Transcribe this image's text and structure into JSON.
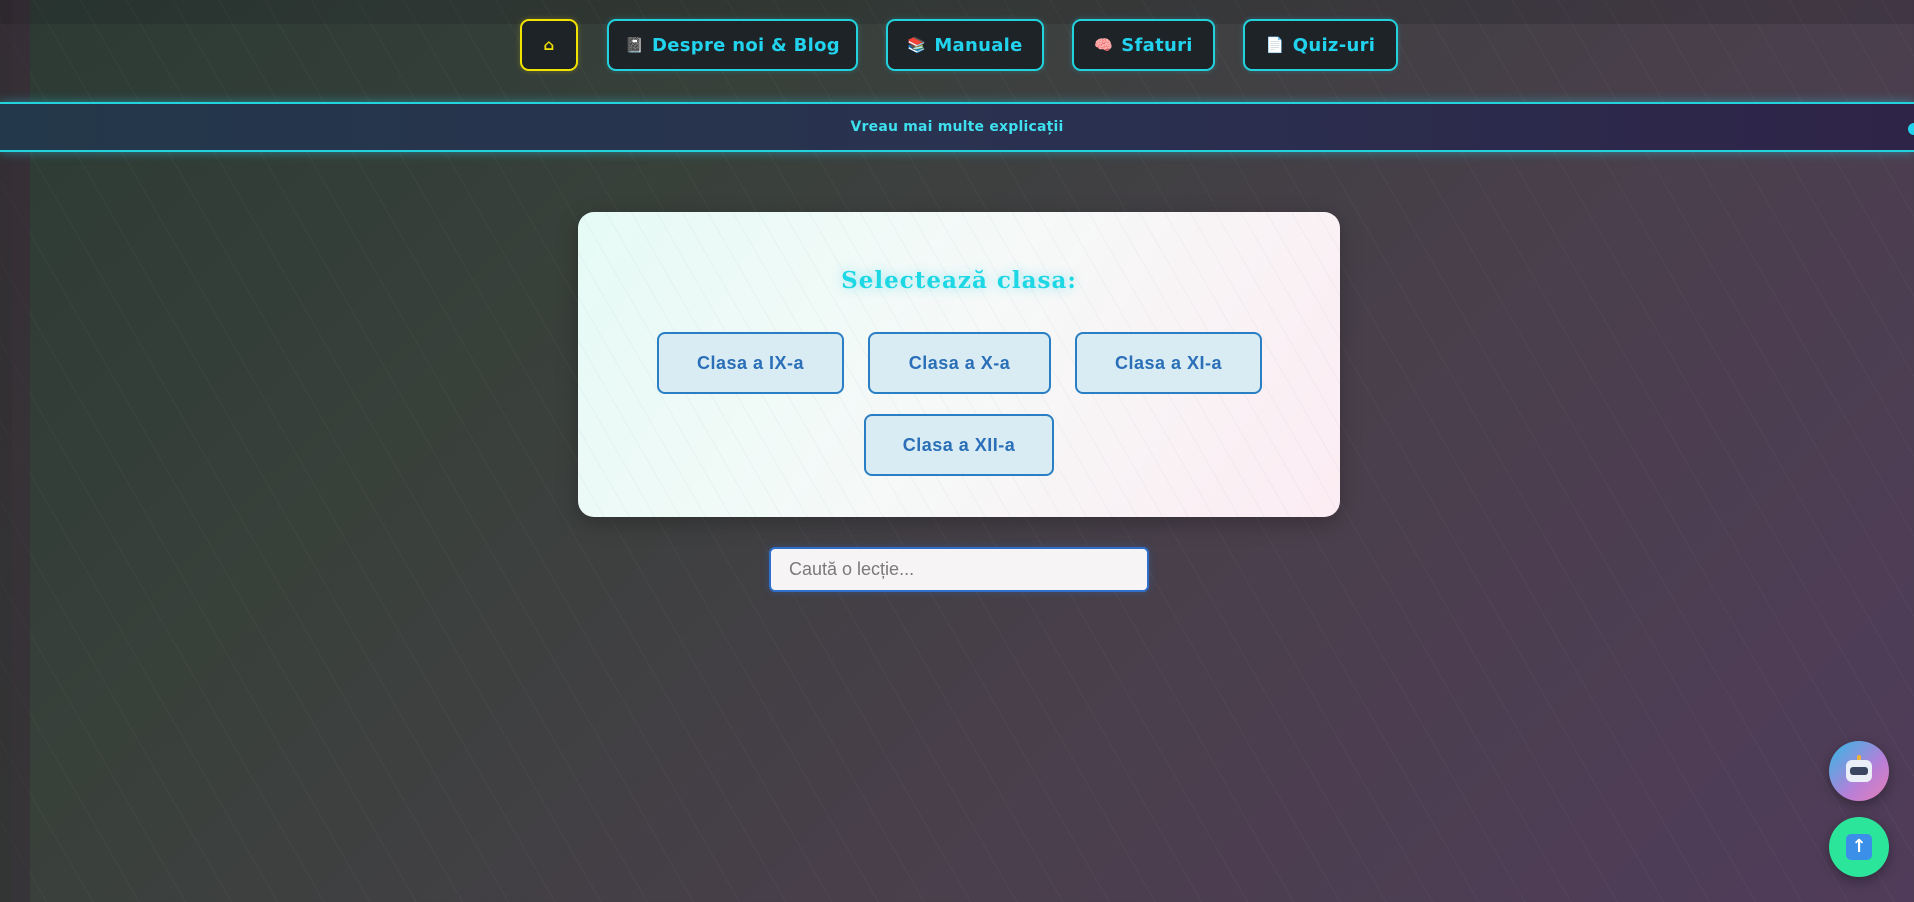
{
  "nav": {
    "home": {
      "icon": "home-icon",
      "glyph": "⌂"
    },
    "items": [
      {
        "label": "Despre noi & Blog",
        "icon": "notebook-icon",
        "glyph": "📓"
      },
      {
        "label": "Manuale",
        "icon": "books-icon",
        "glyph": "📚"
      },
      {
        "label": "Sfaturi",
        "icon": "brain-icon",
        "glyph": "🧠"
      },
      {
        "label": "Quiz-uri",
        "icon": "document-icon",
        "glyph": "📄"
      }
    ]
  },
  "banner": {
    "text": "Vreau mai multe explicații"
  },
  "class_selector": {
    "title": "Selectează clasa:",
    "classes": [
      "Clasa a IX-a",
      "Clasa a X-a",
      "Clasa a XI-a",
      "Clasa a XII-a"
    ]
  },
  "search": {
    "placeholder": "Caută o lecție...",
    "value": ""
  },
  "floating": {
    "chatbot": {
      "icon": "robot-icon"
    },
    "scroll_top": {
      "icon": "arrow-up-icon",
      "glyph": "↑"
    }
  },
  "colors": {
    "accent_cyan": "#22d3ee",
    "home_yellow": "#f2e200",
    "class_blue": "#2a7fc4",
    "fab_green": "#2be59a"
  }
}
